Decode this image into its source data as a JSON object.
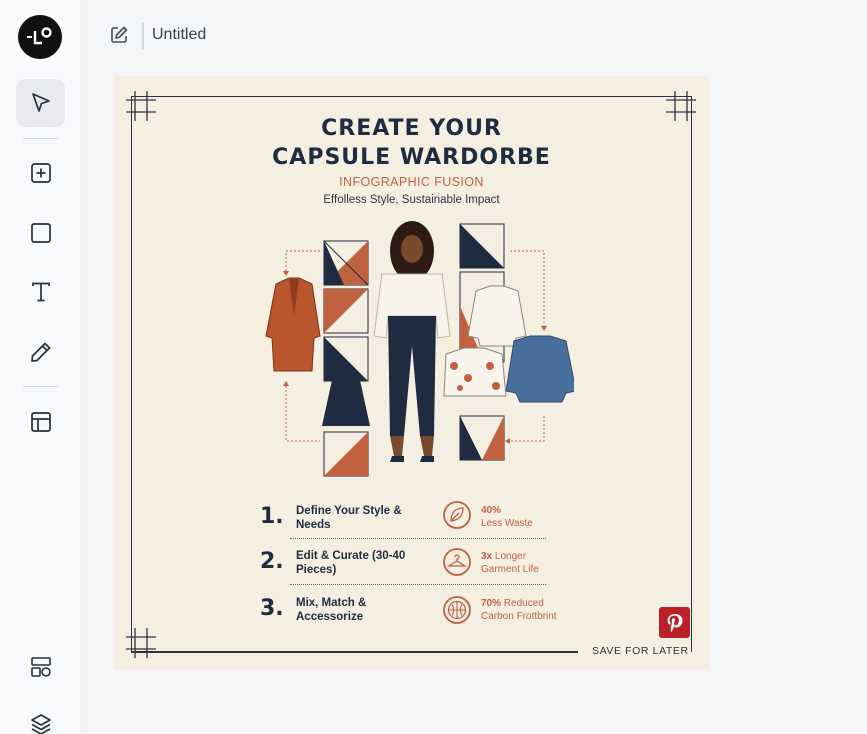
{
  "app": {
    "logo_text": "-LO",
    "doc_title": "Untitled"
  },
  "tools": [
    {
      "name": "select-tool",
      "icon": "cursor-icon",
      "active": true
    },
    {
      "name": "add-frame-tool",
      "icon": "plus-square-icon"
    },
    {
      "name": "rectangle-tool",
      "icon": "square-icon"
    },
    {
      "name": "text-tool",
      "icon": "text-icon"
    },
    {
      "name": "pen-tool",
      "icon": "pencil-icon"
    },
    {
      "name": "layout-tool",
      "icon": "layout-icon"
    },
    {
      "name": "templates-tool",
      "icon": "shapes-grid-icon"
    },
    {
      "name": "layers-tool",
      "icon": "layers-icon"
    }
  ],
  "poster": {
    "title_line1": "CREATE YOUR",
    "title_line2": "CAPSULE WARDORBE",
    "subtitle": "INFOGRAPHIC FUSION",
    "tagline": "Effolless Style, Sustainable Impact",
    "steps": [
      {
        "num": "1.",
        "text": "Define Your Style & Needs"
      },
      {
        "num": "2.",
        "text": "Edit & Curate (30-40 Pieces)"
      },
      {
        "num": "3.",
        "text": "Mix, Match & Accessorize"
      }
    ],
    "stats": [
      {
        "value": "40%",
        "label": "Less Waste",
        "icon": "leaf-icon"
      },
      {
        "value": "3x",
        "label_inline": "Longer",
        "label": "Garment Life",
        "icon": "hanger-icon"
      },
      {
        "value": "70%",
        "label_inline": "Reduced",
        "label": "Carbon Frottbrint",
        "icon": "globe-icon"
      }
    ],
    "cta": "SAVE FOR LATER",
    "share_icon": "pinterest-icon"
  },
  "colors": {
    "navy": "#1f2b40",
    "rust": "#c0613f",
    "cream": "#f5efe1",
    "pinterest": "#bd1f27"
  }
}
